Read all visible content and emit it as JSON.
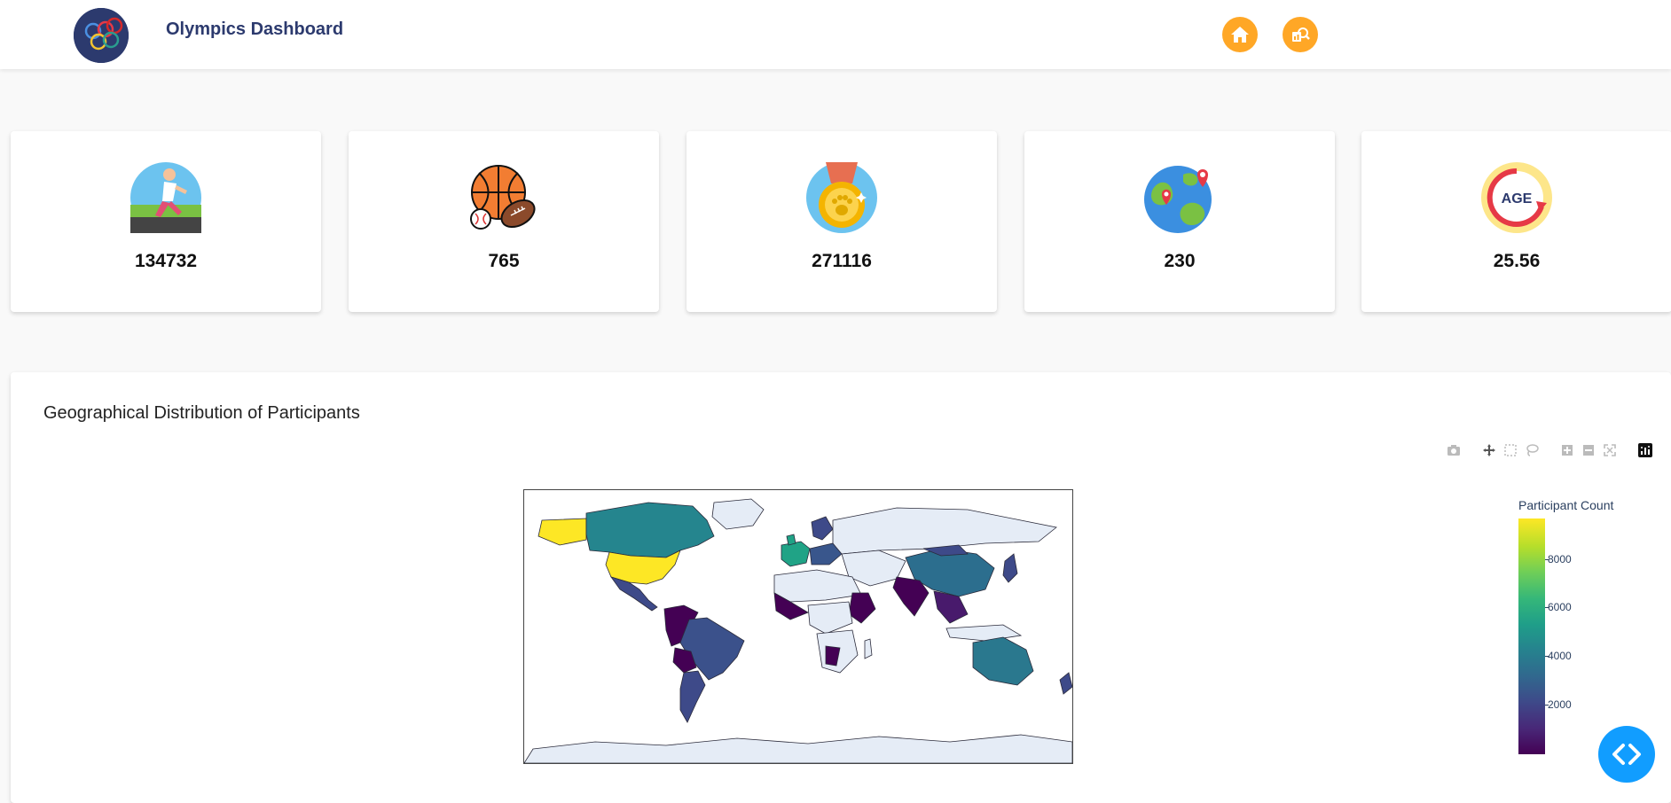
{
  "app": {
    "title": "Olympics Dashboard",
    "logo_icon": "olympic-rings-icon"
  },
  "nav": [
    {
      "id": "home",
      "icon": "home-icon",
      "color": "#ffa726"
    },
    {
      "id": "analysis",
      "icon": "analysis-icon",
      "color": "#ffa726"
    }
  ],
  "stats": [
    {
      "icon": "runner-icon",
      "value": "134732"
    },
    {
      "icon": "sports-balls-icon",
      "value": "765"
    },
    {
      "icon": "medal-icon",
      "value": "271116"
    },
    {
      "icon": "globe-pin-icon",
      "value": "230"
    },
    {
      "icon": "age-icon",
      "value": "25.56"
    }
  ],
  "map_panel": {
    "title": "Geographical Distribution of Participants",
    "modebar": [
      "camera-icon",
      "pan-icon",
      "box-select-icon",
      "lasso-icon",
      "zoom-in-icon",
      "zoom-out-icon",
      "reset-view-icon",
      "plotly-logo-icon"
    ]
  },
  "chart_data": {
    "type": "heatmap",
    "subtype": "choropleth",
    "colorscale": "viridis",
    "colorbar": {
      "title": "Participant Count",
      "ticks": [
        "8000",
        "6000",
        "4000",
        "2000"
      ],
      "range": [
        0,
        9700
      ]
    },
    "regions": [
      {
        "name": "USA",
        "value": 9600
      },
      {
        "name": "Canada",
        "value": 4600
      },
      {
        "name": "Mexico",
        "value": 1200
      },
      {
        "name": "Brazil",
        "value": 2300
      },
      {
        "name": "Argentina",
        "value": 2100
      },
      {
        "name": "Australia",
        "value": 4200
      },
      {
        "name": "China",
        "value": 2400
      },
      {
        "name": "Russia",
        "value": 3000
      },
      {
        "name": "France",
        "value": 5500
      },
      {
        "name": "United Kingdom",
        "value": 5200
      },
      {
        "name": "India",
        "value": 600
      },
      {
        "name": "Japan",
        "value": 3600
      }
    ]
  },
  "fab": {
    "icon": "code-icon",
    "color": "#119dff"
  }
}
